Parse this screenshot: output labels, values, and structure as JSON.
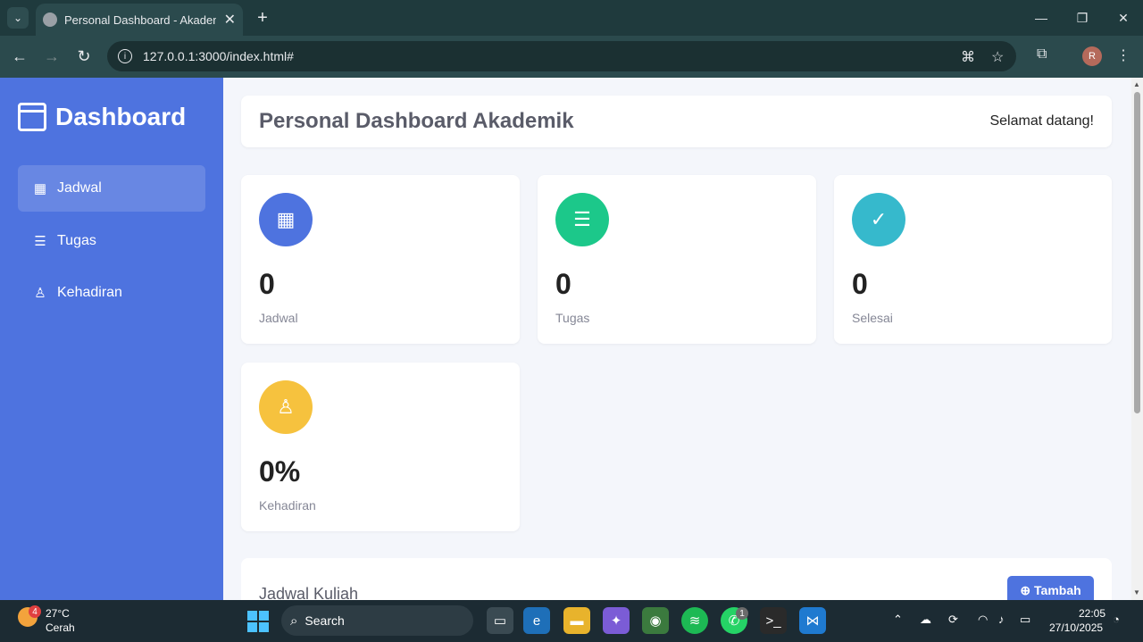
{
  "browser": {
    "tab_title": "Personal Dashboard - Akademik",
    "url": "127.0.0.1:3000/index.html#",
    "profile_initial": "R"
  },
  "sidebar": {
    "brand": "Dashboard",
    "items": [
      {
        "label": "Jadwal",
        "icon": "calendar-icon",
        "active": true
      },
      {
        "label": "Tugas",
        "icon": "list-icon",
        "active": false
      },
      {
        "label": "Kehadiran",
        "icon": "user-icon",
        "active": false
      }
    ],
    "color": "#4e73df"
  },
  "header": {
    "title": "Personal Dashboard Akademik",
    "welcome": "Selamat datang!"
  },
  "stats": [
    {
      "value": "0",
      "label": "Jadwal",
      "icon": "calendar-icon",
      "color": "#4e73df"
    },
    {
      "value": "0",
      "label": "Tugas",
      "icon": "list-icon",
      "color": "#1cc88a"
    },
    {
      "value": "0",
      "label": "Selesai",
      "icon": "check-circle-icon",
      "color": "#36b9cc"
    },
    {
      "value": "0%",
      "label": "Kehadiran",
      "icon": "user-icon",
      "color": "#f6c23e"
    }
  ],
  "section": {
    "title": "Jadwal Kuliah",
    "add_label": "Tambah"
  },
  "taskbar": {
    "weather_temp": "27°C",
    "weather_desc": "Cerah",
    "weather_badge": "4",
    "search_placeholder": "Search",
    "time": "22:05",
    "date": "27/10/2025",
    "whatsapp_badge": "1"
  }
}
